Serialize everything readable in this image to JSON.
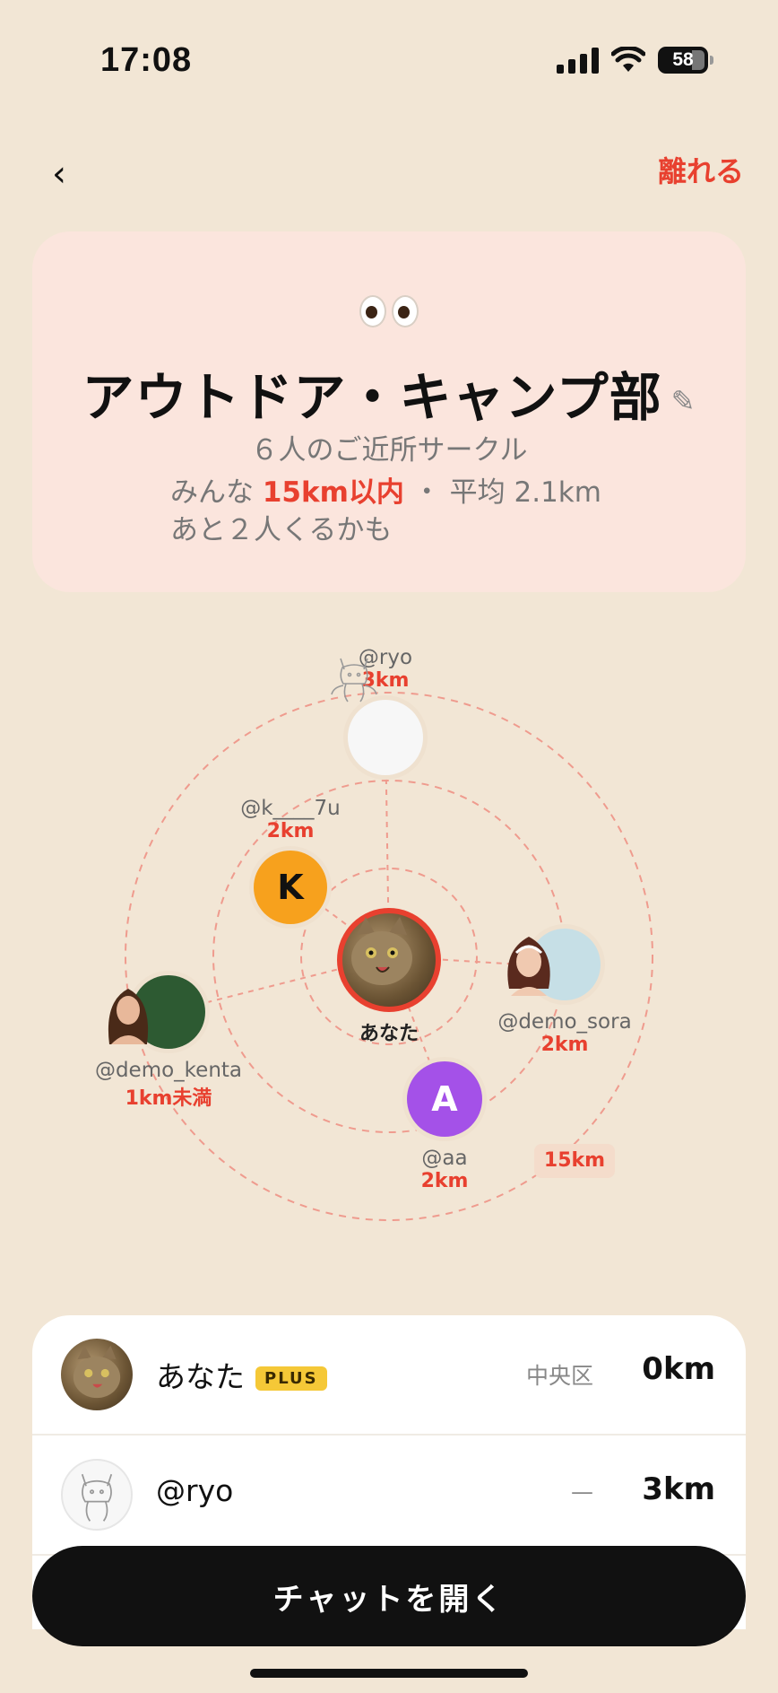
{
  "status_bar": {
    "time": "17:08",
    "battery": "58"
  },
  "header": {
    "back_icon": "chevron-left-icon",
    "leave_label": "離れる"
  },
  "circle": {
    "emoji": "eyes",
    "title": "アウトドア・キャンプ部",
    "edit_icon": "pencil-icon",
    "subtitle": "６人のご近所サークル",
    "info_prefix": "みんな",
    "info_highlight": "15km以内",
    "info_suffix": "・ 平均 2.1km",
    "info_line2": "あと２人くるかも"
  },
  "radar": {
    "ring_label": "15km",
    "center": {
      "label": "あなた"
    },
    "members": [
      {
        "handle": "@ryo",
        "distance": "3km"
      },
      {
        "handle": "@k____7u",
        "distance": "2km",
        "initial": "K"
      },
      {
        "handle": "@demo_sora",
        "distance": "2km"
      },
      {
        "handle": "@demo_kenta",
        "distance": "1km未満"
      },
      {
        "handle": "@aa",
        "distance": "2km",
        "initial": "A"
      }
    ]
  },
  "member_list": [
    {
      "name": "あなた",
      "badge": "PLUS",
      "area": "中央区",
      "distance": "0km"
    },
    {
      "name": "@ryo",
      "area": "—",
      "distance": "3km"
    }
  ],
  "chat_button": {
    "label": "チャットを開く"
  },
  "colors": {
    "accent": "#e8402f",
    "background": "#f2e6d5",
    "card": "#fbe5dd",
    "orange": "#f7a11d",
    "purple": "#a451e8"
  }
}
